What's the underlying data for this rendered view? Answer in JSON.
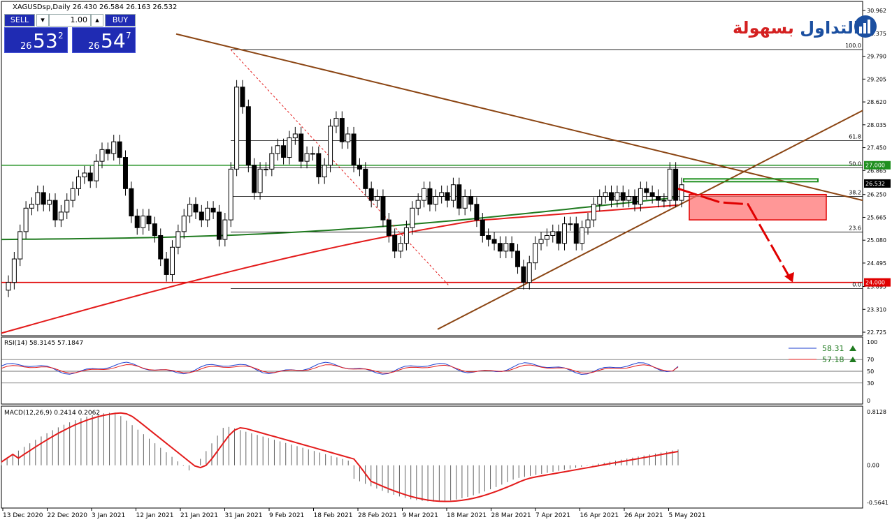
{
  "header": {
    "symbol_info": "XAGUSDsp,Daily  26.430 26.584 26.163 26.532"
  },
  "trade_panel": {
    "sell_label": "SELL",
    "buy_label": "BUY",
    "lot_value": "1.00",
    "sell_small": "26",
    "sell_big": "53",
    "sell_pip": "2",
    "buy_small": "26",
    "buy_big": "54",
    "buy_pip": "7"
  },
  "logo": {
    "text_red": "بسهولة",
    "text_blue": "التداول"
  },
  "colors": {
    "bg": "#ffffff",
    "candle": "#000000",
    "ma_green": "#1f7a1f",
    "ma_red": "#e31b1b",
    "trendline": "#8b4513",
    "fib_line": "#000000",
    "level_green": "#1f8f1f",
    "level_red": "#e00000",
    "zone": "#ff6b6b",
    "arrow": "#e00000",
    "rsi_main": "#1e3fcf",
    "rsi_signal": "#e31b1b",
    "macd_signal": "#e31b1b",
    "macd_hist": "#606060"
  },
  "chart_data": [
    {
      "type": "candlestick",
      "title": "XAGUSDsp,Daily",
      "ylim": [
        22.725,
        30.962
      ],
      "y_ticks": [
        "30.962",
        "30.375",
        "29.790",
        "29.205",
        "28.620",
        "28.035",
        "27.450",
        "26.865",
        "26.250",
        "25.665",
        "25.080",
        "24.495",
        "23.895",
        "23.310",
        "22.725"
      ],
      "x_ticks": [
        "13 Dec 2020",
        "22 Dec 2020",
        "3 Jan 2021",
        "12 Jan 2021",
        "21 Jan 2021",
        "31 Jan 2021",
        "9 Feb 2021",
        "18 Feb 2021",
        "28 Feb 2021",
        "9 Mar 2021",
        "18 Mar 2021",
        "28 Mar 2021",
        "7 Apr 2021",
        "16 Apr 2021",
        "26 Apr 2021",
        "5 May 2021"
      ],
      "current_price": "26.532",
      "ohlc_last": {
        "open": 26.43,
        "high": 26.584,
        "low": 26.163,
        "close": 26.532
      },
      "horizontal_levels": [
        {
          "value": 27.0,
          "label": "27.000",
          "color": "#1f8f1f"
        },
        {
          "value": 24.0,
          "label": "24.000",
          "color": "#e00000"
        }
      ],
      "fib_levels": [
        {
          "label": "100.0",
          "value": 29.96
        },
        {
          "label": "61.8",
          "value": 27.63
        },
        {
          "label": "50.0",
          "value": 26.93
        },
        {
          "label": "38.2",
          "value": 26.2
        },
        {
          "label": "23.6",
          "value": 25.29
        },
        {
          "label": "0.0",
          "value": 23.84
        }
      ],
      "closes": [
        24.0,
        24.6,
        25.3,
        25.9,
        26.0,
        26.3,
        26.0,
        26.1,
        25.6,
        25.8,
        26.1,
        26.4,
        26.7,
        26.8,
        26.6,
        27.1,
        27.4,
        27.3,
        27.6,
        27.2,
        26.4,
        25.7,
        25.4,
        25.7,
        25.5,
        25.2,
        24.6,
        24.2,
        24.9,
        25.3,
        25.7,
        26.0,
        25.8,
        25.6,
        25.9,
        25.8,
        25.1,
        25.6,
        26.9,
        29.0,
        28.5,
        27.0,
        26.3,
        26.9,
        26.9,
        27.3,
        27.5,
        27.2,
        27.7,
        27.8,
        27.1,
        27.3,
        27.3,
        26.7,
        27.0,
        28.0,
        28.2,
        27.6,
        27.8,
        27.0,
        26.9,
        26.4,
        26.1,
        26.2,
        25.6,
        25.2,
        24.8,
        25.0,
        25.4,
        25.9,
        26.1,
        26.4,
        26.0,
        26.2,
        26.3,
        26.1,
        26.5,
        25.9,
        26.2,
        26.0,
        25.6,
        25.2,
        25.1,
        25.0,
        24.8,
        25.0,
        24.8,
        24.4,
        24.0,
        24.5,
        25.0,
        25.1,
        25.2,
        25.3,
        25.0,
        25.5,
        25.5,
        25.0,
        25.4,
        25.6,
        26.0,
        26.2,
        26.3,
        26.1,
        26.3,
        26.1,
        26.2,
        26.0,
        26.4,
        26.3,
        26.2,
        26.1,
        26.1,
        26.9,
        26.1,
        26.5
      ],
      "moving_averages": [
        {
          "name": "green",
          "values_start": 25.1,
          "values_end": 26.1
        },
        {
          "name": "red",
          "values_start": 22.7,
          "values_end": 25.53
        }
      ],
      "projection_zone": {
        "from": 26.25,
        "to": 25.6
      },
      "target_level": 24.0
    },
    {
      "type": "line",
      "title": "RSI(14) 58.3145 57.1847",
      "ylim": [
        0,
        100
      ],
      "y_ticks": [
        "100",
        "70",
        "50",
        "30",
        "0"
      ],
      "series": [
        {
          "name": "RSI",
          "last": 58.31,
          "label": "58.31"
        },
        {
          "name": "Signal",
          "last": 57.18,
          "label": "57.18"
        }
      ]
    },
    {
      "type": "line",
      "title": "MACD(12,26,9) 0.2414 0.2062",
      "ylim": [
        -0.5641,
        0.8128
      ],
      "y_ticks": [
        "0.8128",
        "0.00",
        "-0.5641"
      ],
      "series": [
        {
          "name": "MACD",
          "last": 0.2414
        },
        {
          "name": "Signal",
          "last": 0.2062
        }
      ]
    }
  ]
}
